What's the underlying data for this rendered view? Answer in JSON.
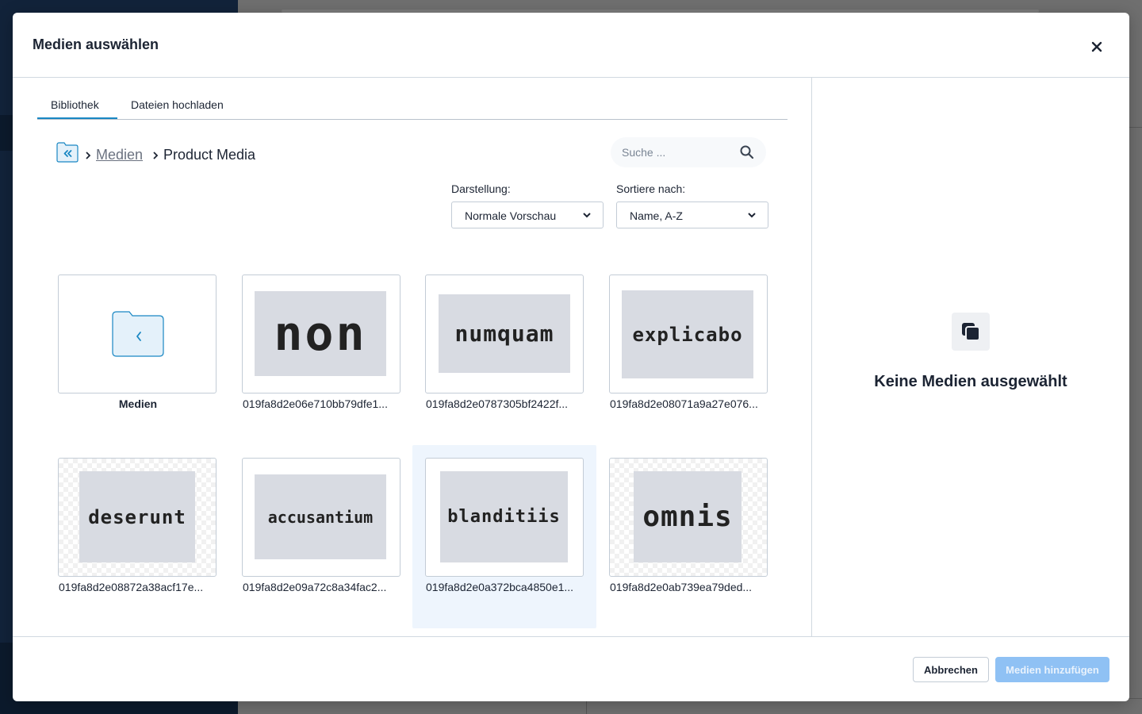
{
  "modal": {
    "title": "Medien auswählen",
    "close_icon": "close-icon"
  },
  "tabs": [
    {
      "label": "Bibliothek",
      "active": true
    },
    {
      "label": "Dateien hochladen",
      "active": false
    }
  ],
  "breadcrumb": {
    "back_icon": "folder-back-icon",
    "root": "Medien",
    "current": "Product Media",
    "separator_icon": "chevron-right-icon"
  },
  "search": {
    "placeholder": "Suche ...",
    "value": "",
    "icon": "search-icon"
  },
  "view_select": {
    "label": "Darstellung:",
    "value": "Normale Vorschau"
  },
  "sort_select": {
    "label": "Sortiere nach:",
    "value": "Name, A-Z"
  },
  "items": [
    {
      "type": "folder",
      "name": "Medien",
      "icon": "folder-back-icon"
    },
    {
      "type": "image",
      "name": "019fa8d2e06e710bb79dfe1...",
      "image_text": "non",
      "selected": false
    },
    {
      "type": "image",
      "name": "019fa8d2e0787305bf2422f...",
      "image_text": "numquam",
      "selected": false
    },
    {
      "type": "image",
      "name": "019fa8d2e08071a9a27e076...",
      "image_text": "explicabo",
      "selected": false
    },
    {
      "type": "image",
      "name": "019fa8d2e08872a38acf17e...",
      "image_text": "deserunt",
      "selected": false
    },
    {
      "type": "image",
      "name": "019fa8d2e09a72c8a34fac2...",
      "image_text": "accusantium",
      "selected": false
    },
    {
      "type": "image",
      "name": "019fa8d2e0a372bca4850e1...",
      "image_text": "blanditiis",
      "selected": true
    },
    {
      "type": "image",
      "name": "019fa8d2e0ab739ea79ded...",
      "image_text": "omnis",
      "selected": false
    }
  ],
  "sidebar_empty": {
    "icon": "copy-icon",
    "text": "Keine Medien ausgewählt"
  },
  "footer": {
    "cancel_label": "Abbrechen",
    "add_label": "Medien hinzufügen",
    "add_disabled": true
  },
  "colors": {
    "accent": "#1987c3",
    "selected_bg": "#eef5fd",
    "disabled_button": "#8fc1f4"
  }
}
